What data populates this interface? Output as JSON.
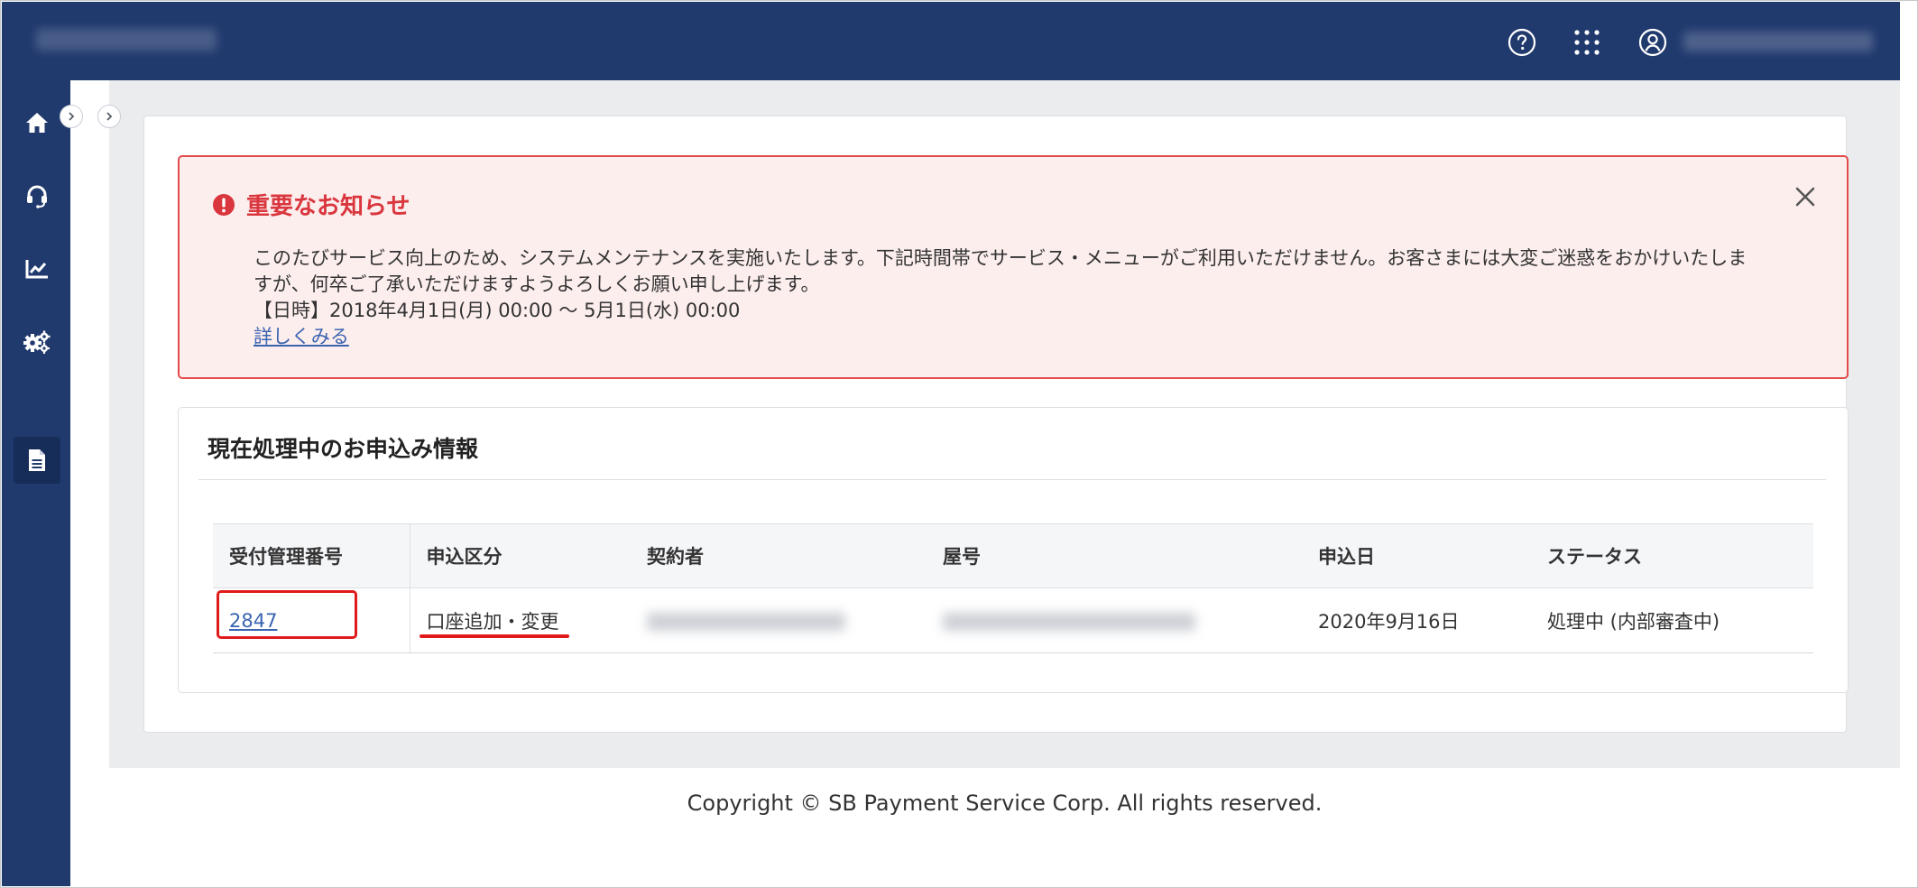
{
  "header": {
    "icons": {
      "help": "question-circle-icon",
      "apps": "grid-dots-icon",
      "user": "user-circle-icon"
    }
  },
  "sidebar": {
    "items": [
      {
        "icon": "home-icon"
      },
      {
        "icon": "headset-icon"
      },
      {
        "icon": "chart-icon"
      },
      {
        "icon": "gears-icon"
      },
      {
        "icon": "document-icon",
        "active": true
      }
    ]
  },
  "notice": {
    "title": "重要なお知らせ",
    "line1": "このたびサービス向上のため、システムメンテナンスを実施いたします。下記時間帯でサービス・メニューがご利用いただけません。お客さまには大変ご迷惑をおかけいたしま",
    "line2": "すが、何卒ご了承いただけますようよろしくお願い申し上げます。",
    "line3": "【日時】2018年4月1日(月) 00:00 ～ 5月1日(水) 00:00",
    "link": "詳しくみる"
  },
  "applications": {
    "title": "現在処理中のお申込み情報",
    "columns": [
      "受付管理番号",
      "申込区分",
      "契約者",
      "屋号",
      "申込日",
      "ステータス"
    ],
    "rows": [
      {
        "id": "2847",
        "type": "口座追加・変更",
        "date": "2020年9月16日",
        "status": "処理中 (内部審査中)"
      }
    ]
  },
  "footer": {
    "copyright": "Copyright © SB Payment Service Corp. All rights reserved."
  },
  "colors": {
    "header_bg": "#213a6e",
    "notice_border": "#e24b4b",
    "notice_bg": "#fdeeee",
    "link": "#3a64b0",
    "highlight_red": "#e01a1a"
  }
}
